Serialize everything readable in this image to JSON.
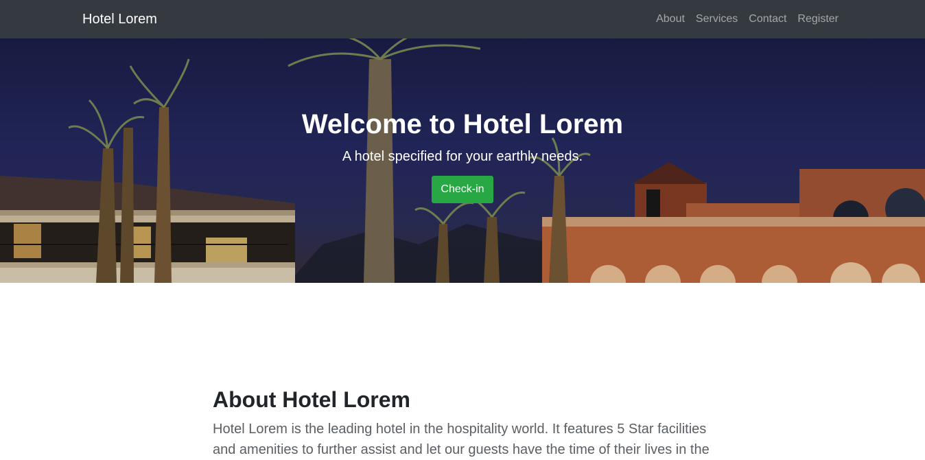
{
  "navbar": {
    "brand": "Hotel Lorem",
    "links": [
      "About",
      "Services",
      "Contact",
      "Register"
    ]
  },
  "hero": {
    "title": "Welcome to Hotel Lorem",
    "subtitle": "A hotel specified for your earthly needs.",
    "button_label": "Check-in"
  },
  "about": {
    "title": "About Hotel Lorem",
    "text": "Hotel Lorem is the leading hotel in the hospitality world. It features 5 Star facilities and amenities to further assist and let our guests have the time of their lives in the"
  },
  "colors": {
    "navbar_bg": "#343a40",
    "button_bg": "#28a745",
    "sky": "#262a63"
  }
}
